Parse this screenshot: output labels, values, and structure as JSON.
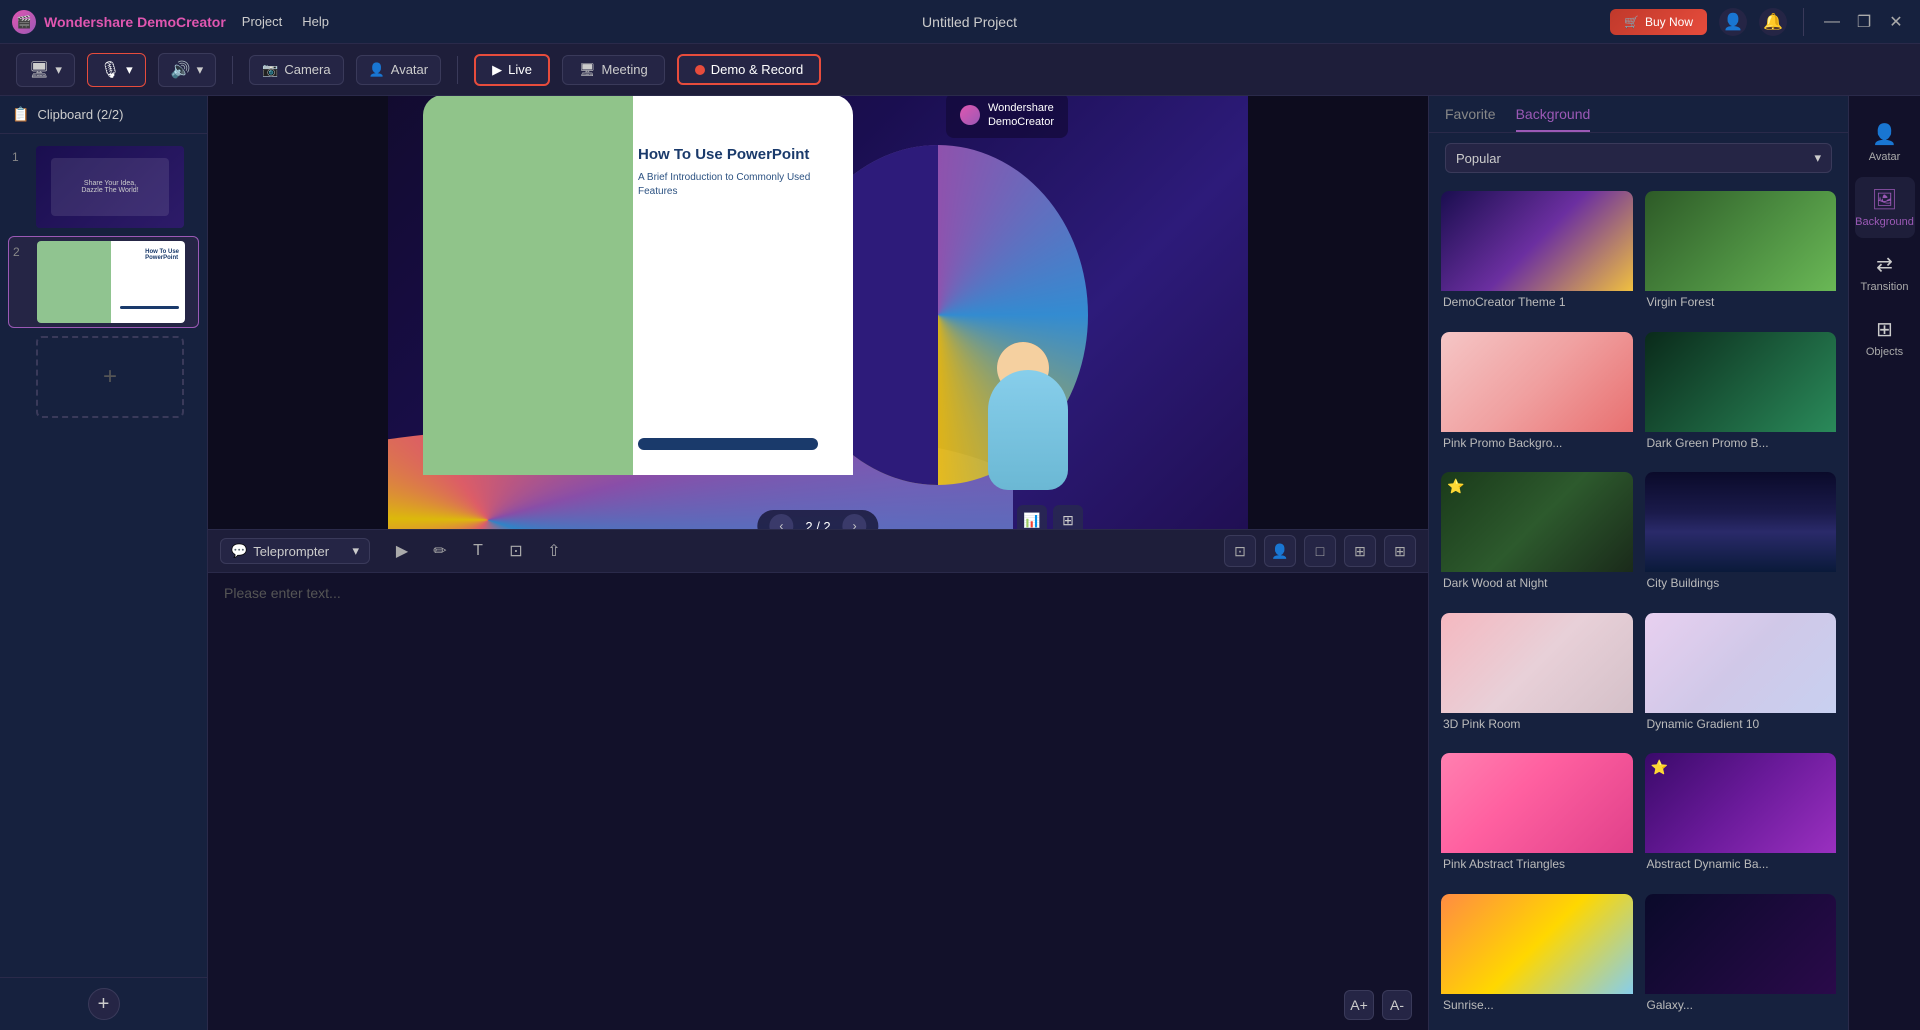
{
  "app": {
    "name": "Wondershare DemoCreator",
    "logo_icon": "🎬",
    "project_title": "Untitled Project"
  },
  "menu": {
    "items": [
      "Project",
      "Help"
    ]
  },
  "titlebar": {
    "buy_now": "Buy Now",
    "window_min": "—",
    "window_max": "❐",
    "window_close": "✕"
  },
  "toolbar": {
    "mic_icon": "🎙",
    "volume_icon": "🔊",
    "camera_label": "Camera",
    "avatar_label": "Avatar",
    "live_label": "Live",
    "meeting_label": "Meeting",
    "demo_record_label": "Demo & Record"
  },
  "left_panel": {
    "clipboard_label": "Clipboard (2/2)",
    "slide1_num": "1",
    "slide2_num": "2",
    "add_clip_icon": "+"
  },
  "canvas": {
    "logo_text": "Wondershare\nDemoCreator",
    "slide_title": "How To Use PowerPoint",
    "slide_subtitle": "A Brief Introduction to Commonly Used Features",
    "page_prev": "‹",
    "page_indicator": "2 / 2",
    "page_next": "›",
    "avatar_ctrl1": "📊",
    "avatar_ctrl2": "⊞"
  },
  "teleprompter": {
    "label": "Teleprompter",
    "dropdown_icon": "▾",
    "placeholder": "Please enter text...",
    "tool_play": "▶",
    "tool_pen": "✏",
    "tool_text": "T",
    "tool_crop": "⊡",
    "tool_share": "⇧",
    "right_tool1": "⊡",
    "right_tool2": "👤",
    "right_tool3": "□",
    "right_tool4": "⊞",
    "right_tool5": "⊞",
    "font_larger": "A+",
    "font_smaller": "A-"
  },
  "right_panel": {
    "tab_favorite": "Favorite",
    "tab_background": "Background",
    "filter_label": "Popular",
    "filter_icon": "▾",
    "backgrounds": [
      {
        "id": "democreator",
        "label": "DemoCreator Theme 1",
        "class": "bg-democreator",
        "fav": false
      },
      {
        "id": "virgin-forest",
        "label": "Virgin Forest",
        "class": "bg-virgin-forest",
        "fav": false
      },
      {
        "id": "pink-promo",
        "label": "Pink Promo Backgro...",
        "class": "bg-pink-promo",
        "fav": false
      },
      {
        "id": "dark-green",
        "label": "Dark Green Promo B...",
        "class": "bg-dark-green",
        "fav": false
      },
      {
        "id": "dark-wood",
        "label": "Dark Wood at Night",
        "class": "bg-dark-wood",
        "fav": true
      },
      {
        "id": "city",
        "label": "City Buildings",
        "class": "bg-city",
        "fav": false
      },
      {
        "id": "3d-pink",
        "label": "3D Pink Room",
        "class": "bg-3d-pink",
        "fav": false
      },
      {
        "id": "dynamic-10",
        "label": "Dynamic Gradient 10",
        "class": "bg-dynamic-10",
        "fav": false
      },
      {
        "id": "pink-abstract",
        "label": "Pink Abstract Triangles",
        "class": "bg-pink-abstract",
        "fav": false
      },
      {
        "id": "abstract-dynamic",
        "label": "Abstract Dynamic Ba...",
        "class": "bg-abstract-dynamic",
        "fav": true
      },
      {
        "id": "sunrise",
        "label": "Sunrise...",
        "class": "bg-sunrise",
        "fav": false
      },
      {
        "id": "galaxy",
        "label": "Galaxy...",
        "class": "bg-galaxy",
        "fav": false
      }
    ]
  },
  "icon_panel": {
    "items": [
      {
        "id": "avatar",
        "icon": "👤",
        "label": "Avatar"
      },
      {
        "id": "background",
        "icon": "🖼",
        "label": "Background",
        "active": true
      },
      {
        "id": "transition",
        "icon": "⇄",
        "label": "Transition"
      },
      {
        "id": "objects",
        "icon": "⊞",
        "label": "Objects"
      }
    ]
  }
}
